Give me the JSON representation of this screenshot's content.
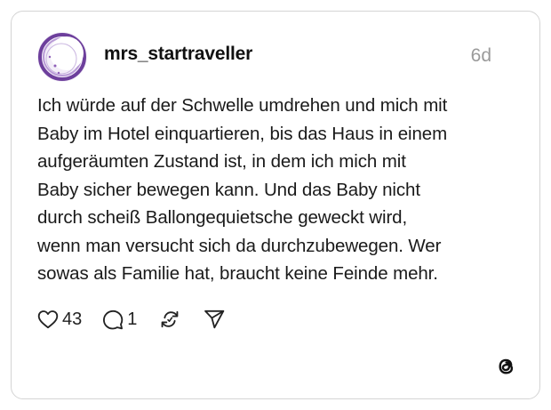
{
  "post": {
    "username": "mrs_startraveller",
    "time": "6d",
    "text_lines": [
      "Ich würde auf der Schwelle umdrehen und mich mit",
      "Baby im Hotel einquartieren, bis das Haus in einem",
      "aufgeräumten Zustand ist, in dem ich mich mit",
      "Baby sicher bewegen kann. Und das Baby nicht",
      "durch scheiß Ballongequietsche geweckt wird,",
      "wenn man versucht sich da durchzubewegen. Wer",
      "sowas als Familie hat, braucht keine Feinde mehr."
    ]
  },
  "actions": {
    "likes": "43",
    "replies": "1"
  },
  "icons": {
    "avatar": "crescent-moon-avatar",
    "like": "heart-icon",
    "reply": "speech-bubble-icon",
    "repost": "repost-icon",
    "share": "send-icon",
    "brand": "threads-logo-icon"
  },
  "colors": {
    "avatar_accent": "#8e5fb8",
    "border": "#d4d4d4",
    "muted": "#9a9a9a"
  }
}
